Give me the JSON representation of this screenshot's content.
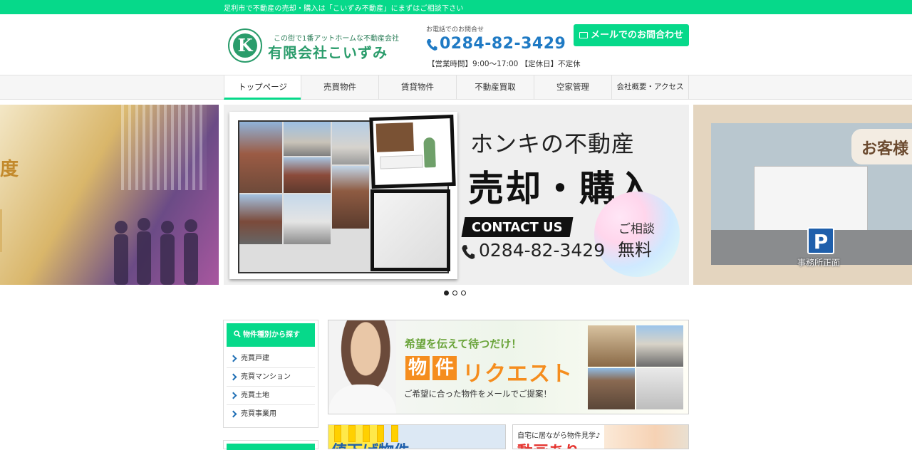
{
  "topbar": {
    "text": "足利市で不動産の売却・購入は「こいずみ不動産」にまずはご相談下さい"
  },
  "header": {
    "logo_letter": "K",
    "tagline": "この街で1番アットホームな不動産会社",
    "company": "有限会社こいずみ",
    "phone_caption": "お電話でのお問合せ",
    "phone": "0284-82-3429",
    "hours": "【営業時間】9:00～17:00 【定休日】不定休",
    "mail_button": "メールでのお問合わせ"
  },
  "nav": {
    "items": [
      {
        "label": "トップページ",
        "active": true
      },
      {
        "label": "売買物件"
      },
      {
        "label": "賃貸物件"
      },
      {
        "label": "不動産買取"
      },
      {
        "label": "空家管理"
      },
      {
        "label": "会社概要・アクセス"
      }
    ]
  },
  "slider": {
    "left_text": "度",
    "main": {
      "line1": "ホンキの不動産",
      "line2": "売却・購入",
      "contact": "CONTACT US",
      "phone": "0284-82-3429",
      "consult": "ご相談",
      "free": "無料"
    },
    "right": {
      "parking": "P",
      "caption": "事務所正面",
      "greeting": "お客様"
    },
    "dots": 3,
    "active_dot": 1
  },
  "sidebar": {
    "heading": "物件種別から探す",
    "items": [
      "売買戸建",
      "売買マンション",
      "売買土地",
      "売買事業用"
    ]
  },
  "banner": {
    "subtitle": "希望を伝えて待つだけ！",
    "box1": "物",
    "box2": "件",
    "main": "リクエスト",
    "desc": "ご希望に合った物件をメールでご提案！"
  },
  "promos": {
    "left_text": "値下げ物件",
    "right_sub": "自宅に居ながら物件見学♪",
    "right_big": "動画あり"
  },
  "colors": {
    "accent": "#06d98a",
    "phone_blue": "#1f7ac4",
    "logo_green": "#2a9c6b",
    "orange": "#f58d1e"
  }
}
